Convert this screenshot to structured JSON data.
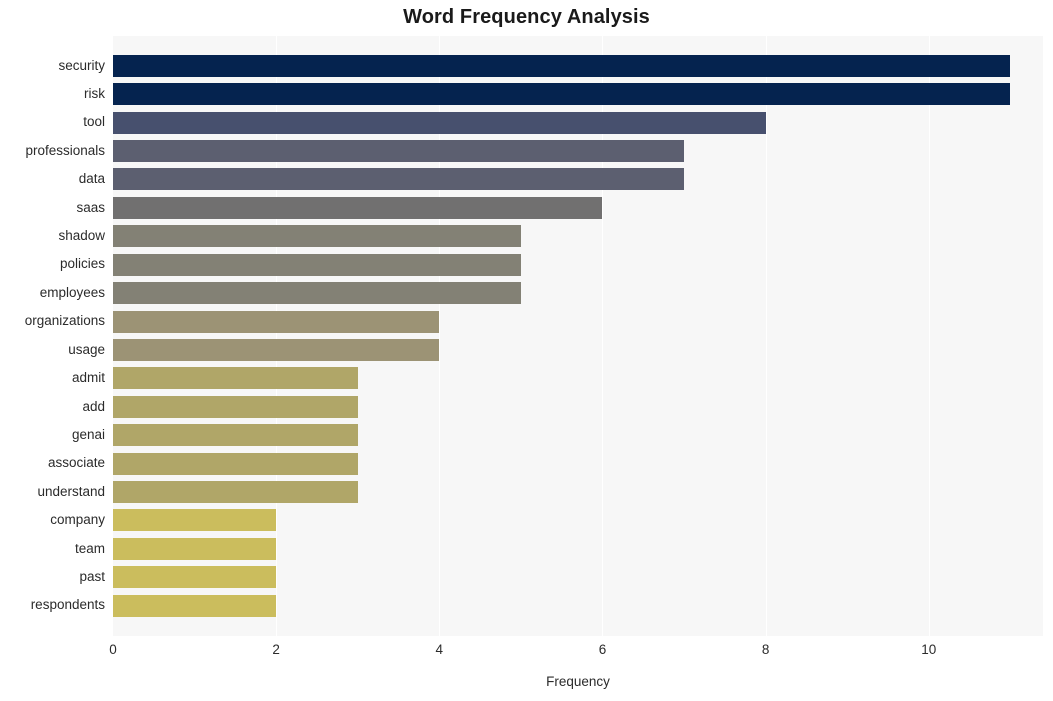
{
  "chart_data": {
    "type": "bar",
    "orientation": "horizontal",
    "title": "Word Frequency Analysis",
    "xlabel": "Frequency",
    "ylabel": "",
    "categories": [
      "security",
      "risk",
      "tool",
      "professionals",
      "data",
      "saas",
      "shadow",
      "policies",
      "employees",
      "organizations",
      "usage",
      "admit",
      "add",
      "genai",
      "associate",
      "understand",
      "company",
      "team",
      "past",
      "respondents"
    ],
    "values": [
      11,
      11,
      8,
      7,
      7,
      6,
      5,
      5,
      5,
      4,
      4,
      3,
      3,
      3,
      3,
      3,
      2,
      2,
      2,
      2
    ],
    "bar_colors": [
      "#05234f",
      "#05234f",
      "#47506e",
      "#5c5f70",
      "#5c5f70",
      "#717070",
      "#838175",
      "#838175",
      "#838175",
      "#9c9375",
      "#9c9375",
      "#b0a668",
      "#b0a668",
      "#b0a668",
      "#b0a668",
      "#b0a668",
      "#cbbd5d",
      "#cbbd5d",
      "#cbbd5d",
      "#cbbd5d"
    ],
    "xticks": [
      0,
      2,
      4,
      6,
      8,
      10
    ],
    "xlim": [
      0,
      11.4
    ],
    "grid": true,
    "grid_axis": "x",
    "legend": false,
    "plot_background": "#f7f7f7",
    "figure_background": "#ffffff",
    "gridline_color": "#ffffff"
  }
}
